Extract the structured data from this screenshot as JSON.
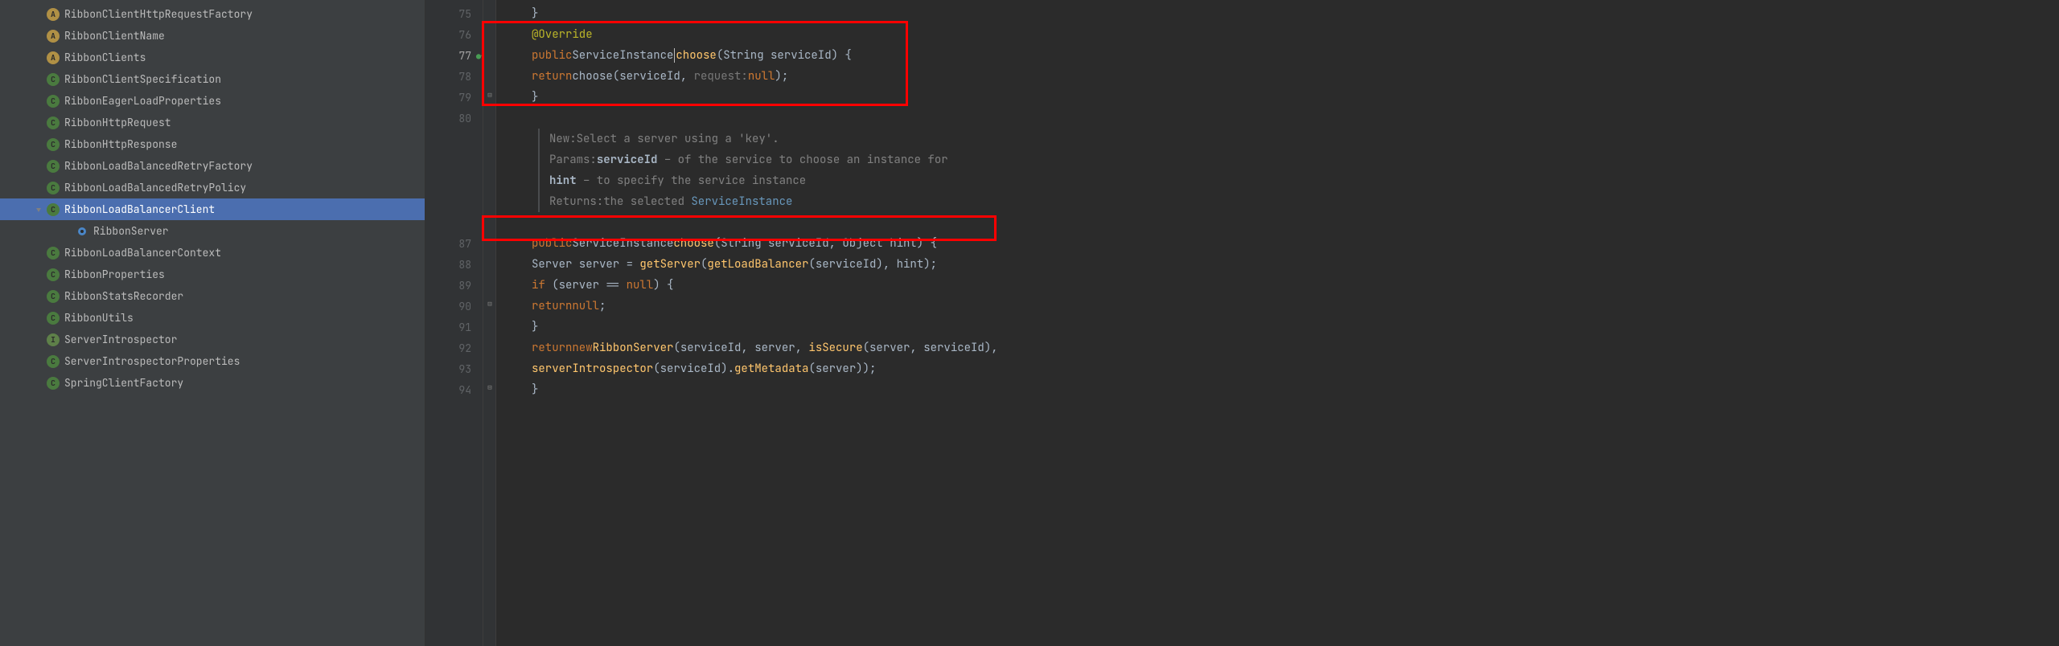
{
  "sidebar": {
    "items": [
      {
        "icon": "A",
        "iconClass": "icon-annotation",
        "label": "RibbonClientHttpRequestFactory"
      },
      {
        "icon": "A",
        "iconClass": "icon-annotation",
        "label": "RibbonClientName"
      },
      {
        "icon": "A",
        "iconClass": "icon-annotation",
        "label": "RibbonClients"
      },
      {
        "icon": "C",
        "iconClass": "icon-class",
        "label": "RibbonClientSpecification"
      },
      {
        "icon": "C",
        "iconClass": "icon-class",
        "label": "RibbonEagerLoadProperties"
      },
      {
        "icon": "C",
        "iconClass": "icon-class",
        "label": "RibbonHttpRequest"
      },
      {
        "icon": "C",
        "iconClass": "icon-class",
        "label": "RibbonHttpResponse"
      },
      {
        "icon": "C",
        "iconClass": "icon-class",
        "label": "RibbonLoadBalancedRetryFactory"
      },
      {
        "icon": "C",
        "iconClass": "icon-class",
        "label": "RibbonLoadBalancedRetryPolicy"
      },
      {
        "icon": "C",
        "iconClass": "icon-class",
        "label": "RibbonLoadBalancerClient",
        "selected": true,
        "expanded": true
      },
      {
        "icon": "",
        "iconClass": "icon-server",
        "label": "RibbonServer",
        "child": true
      },
      {
        "icon": "C",
        "iconClass": "icon-class",
        "label": "RibbonLoadBalancerContext"
      },
      {
        "icon": "C",
        "iconClass": "icon-class",
        "label": "RibbonProperties"
      },
      {
        "icon": "C",
        "iconClass": "icon-class",
        "label": "RibbonStatsRecorder"
      },
      {
        "icon": "C",
        "iconClass": "icon-class",
        "label": "RibbonUtils"
      },
      {
        "icon": "I",
        "iconClass": "icon-interface",
        "label": "ServerIntrospector"
      },
      {
        "icon": "C",
        "iconClass": "icon-class",
        "label": "ServerIntrospectorProperties"
      },
      {
        "icon": "C",
        "iconClass": "icon-class",
        "label": "SpringClientFactory"
      }
    ]
  },
  "gutter": {
    "lines": [
      "75",
      "76",
      "77",
      "78",
      "79",
      "80",
      "",
      "",
      "",
      "",
      "",
      "87",
      "88",
      "89",
      "90",
      "91",
      "92",
      "93",
      "94"
    ],
    "activeLine": "77"
  },
  "code": {
    "l75": "}",
    "l76_anno": "@Override",
    "l77_kw1": "public",
    "l77_type": "ServiceInstance",
    "l77_method": "choose",
    "l77_sig": "(String serviceId) {",
    "l78_kw": "return",
    "l78_call": "choose(serviceId, ",
    "l78_hint": "request:",
    "l78_null": "null",
    "l78_end": ");",
    "l79": "}",
    "doc_new_label": "New:",
    "doc_new_text": "Select a server using a 'key'.",
    "doc_params_label": "Params:",
    "doc_param1": "serviceId",
    "doc_param1_text": " – of the service to choose an instance for",
    "doc_param2": "hint",
    "doc_param2_text": " – to specify the service instance",
    "doc_returns_label": "Returns:",
    "doc_returns_text": "the selected ",
    "doc_returns_link": "ServiceInstance",
    "l87_kw": "public",
    "l87_type": "ServiceInstance",
    "l87_method": "choose",
    "l87_sig": "(String serviceId, Object hint) {",
    "l88_pre": "Server server = ",
    "l88_m1": "getServer",
    "l88_p1": "(",
    "l88_m2": "getLoadBalancer",
    "l88_p2": "(serviceId), hint);",
    "l89_kw": "if",
    "l89_cond": " (server == ",
    "l89_null": "null",
    "l89_end": ") {",
    "l90_kw": "return",
    "l90_null": "null",
    "l90_end": ";",
    "l91": "}",
    "l92_kw1": "return",
    "l92_kw2": "new",
    "l92_ctor": "RibbonServer",
    "l92_args": "(serviceId, server, ",
    "l92_m": "isSecure",
    "l92_args2": "(server, serviceId),",
    "l93_m1": "serverIntrospector",
    "l93_p1": "(serviceId).",
    "l93_m2": "getMetadata",
    "l93_p2": "(server));",
    "l94": "}"
  }
}
